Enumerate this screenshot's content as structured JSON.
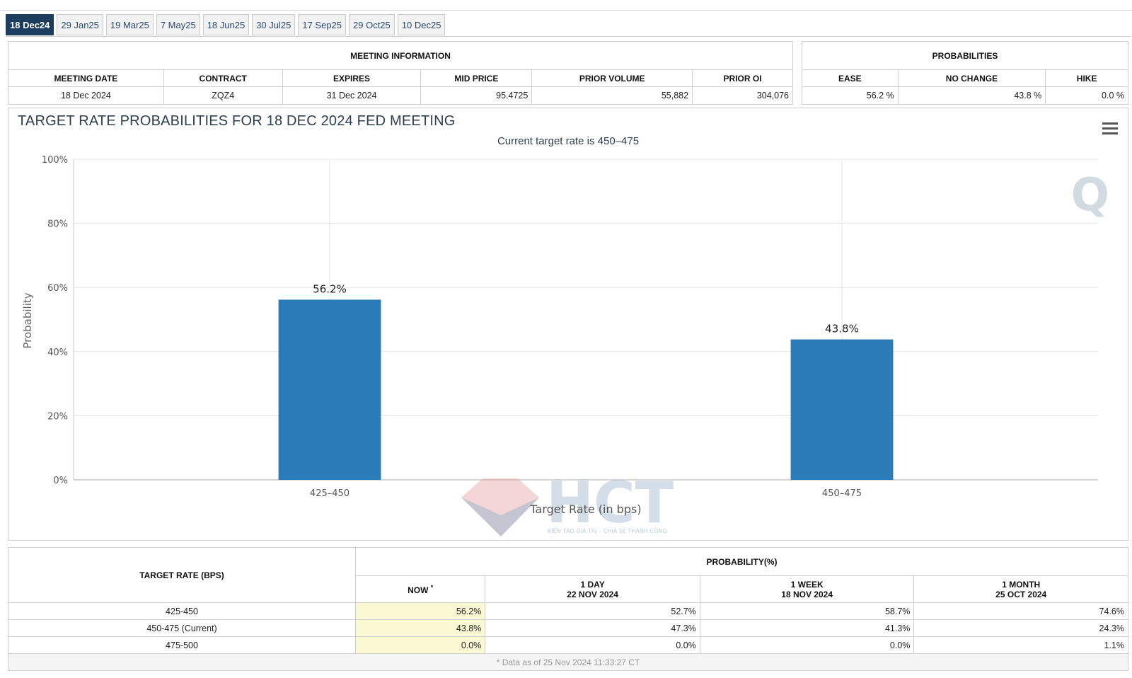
{
  "tabs": [
    "18 Dec24",
    "29 Jan25",
    "19 Mar25",
    "7 May25",
    "18 Jun25",
    "30 Jul25",
    "17 Sep25",
    "29 Oct25",
    "10 Dec25"
  ],
  "meeting_info": {
    "header": "MEETING INFORMATION",
    "columns": [
      "MEETING DATE",
      "CONTRACT",
      "EXPIRES",
      "MID PRICE",
      "PRIOR VOLUME",
      "PRIOR OI"
    ],
    "row": [
      "18 Dec 2024",
      "ZQZ4",
      "31 Dec 2024",
      "95.4725",
      "55,882",
      "304,076"
    ]
  },
  "probabilities": {
    "header": "PROBABILITIES",
    "columns": [
      "EASE",
      "NO CHANGE",
      "HIKE"
    ],
    "row": [
      "56.2 %",
      "43.8 %",
      "0.0 %"
    ]
  },
  "chart_data": {
    "type": "bar",
    "title": "TARGET RATE PROBABILITIES FOR 18 DEC 2024 FED MEETING",
    "subtitle": "Current target rate is 450–475",
    "xlabel": "Target Rate (in bps)",
    "ylabel": "Probability",
    "categories": [
      "425–450",
      "450–475"
    ],
    "values": [
      56.2,
      43.8
    ],
    "data_labels": [
      "56.2%",
      "43.8%"
    ],
    "ylim": [
      0,
      100
    ],
    "yticks": [
      "0%",
      "20%",
      "40%",
      "60%",
      "80%",
      "100%"
    ],
    "grid": true,
    "bar_color": "#2b7bb9"
  },
  "watermark": {
    "brand": "HCT",
    "tagline": "KIẾN TẠO GIÁ TRỊ – CHIA SẺ THÀNH CÔNG"
  },
  "rates_table": {
    "rate_header": "TARGET RATE (BPS)",
    "prob_header": "PROBABILITY(%)",
    "now_label": "NOW",
    "now_marker": "*",
    "day_label": "1 DAY",
    "day_date": "22 NOV 2024",
    "week_label": "1 WEEK",
    "week_date": "18 NOV 2024",
    "month_label": "1 MONTH",
    "month_date": "25 OCT 2024",
    "rows": [
      {
        "rate": "425-450",
        "now": "56.2%",
        "day": "52.7%",
        "week": "58.7%",
        "month": "74.6%"
      },
      {
        "rate": "450-475 (Current)",
        "now": "43.8%",
        "day": "47.3%",
        "week": "41.3%",
        "month": "24.3%"
      },
      {
        "rate": "475-500",
        "now": "0.0%",
        "day": "0.0%",
        "week": "0.0%",
        "month": "1.1%"
      }
    ],
    "footnote": "* Data as of 25 Nov 2024 11:33:27 CT"
  }
}
